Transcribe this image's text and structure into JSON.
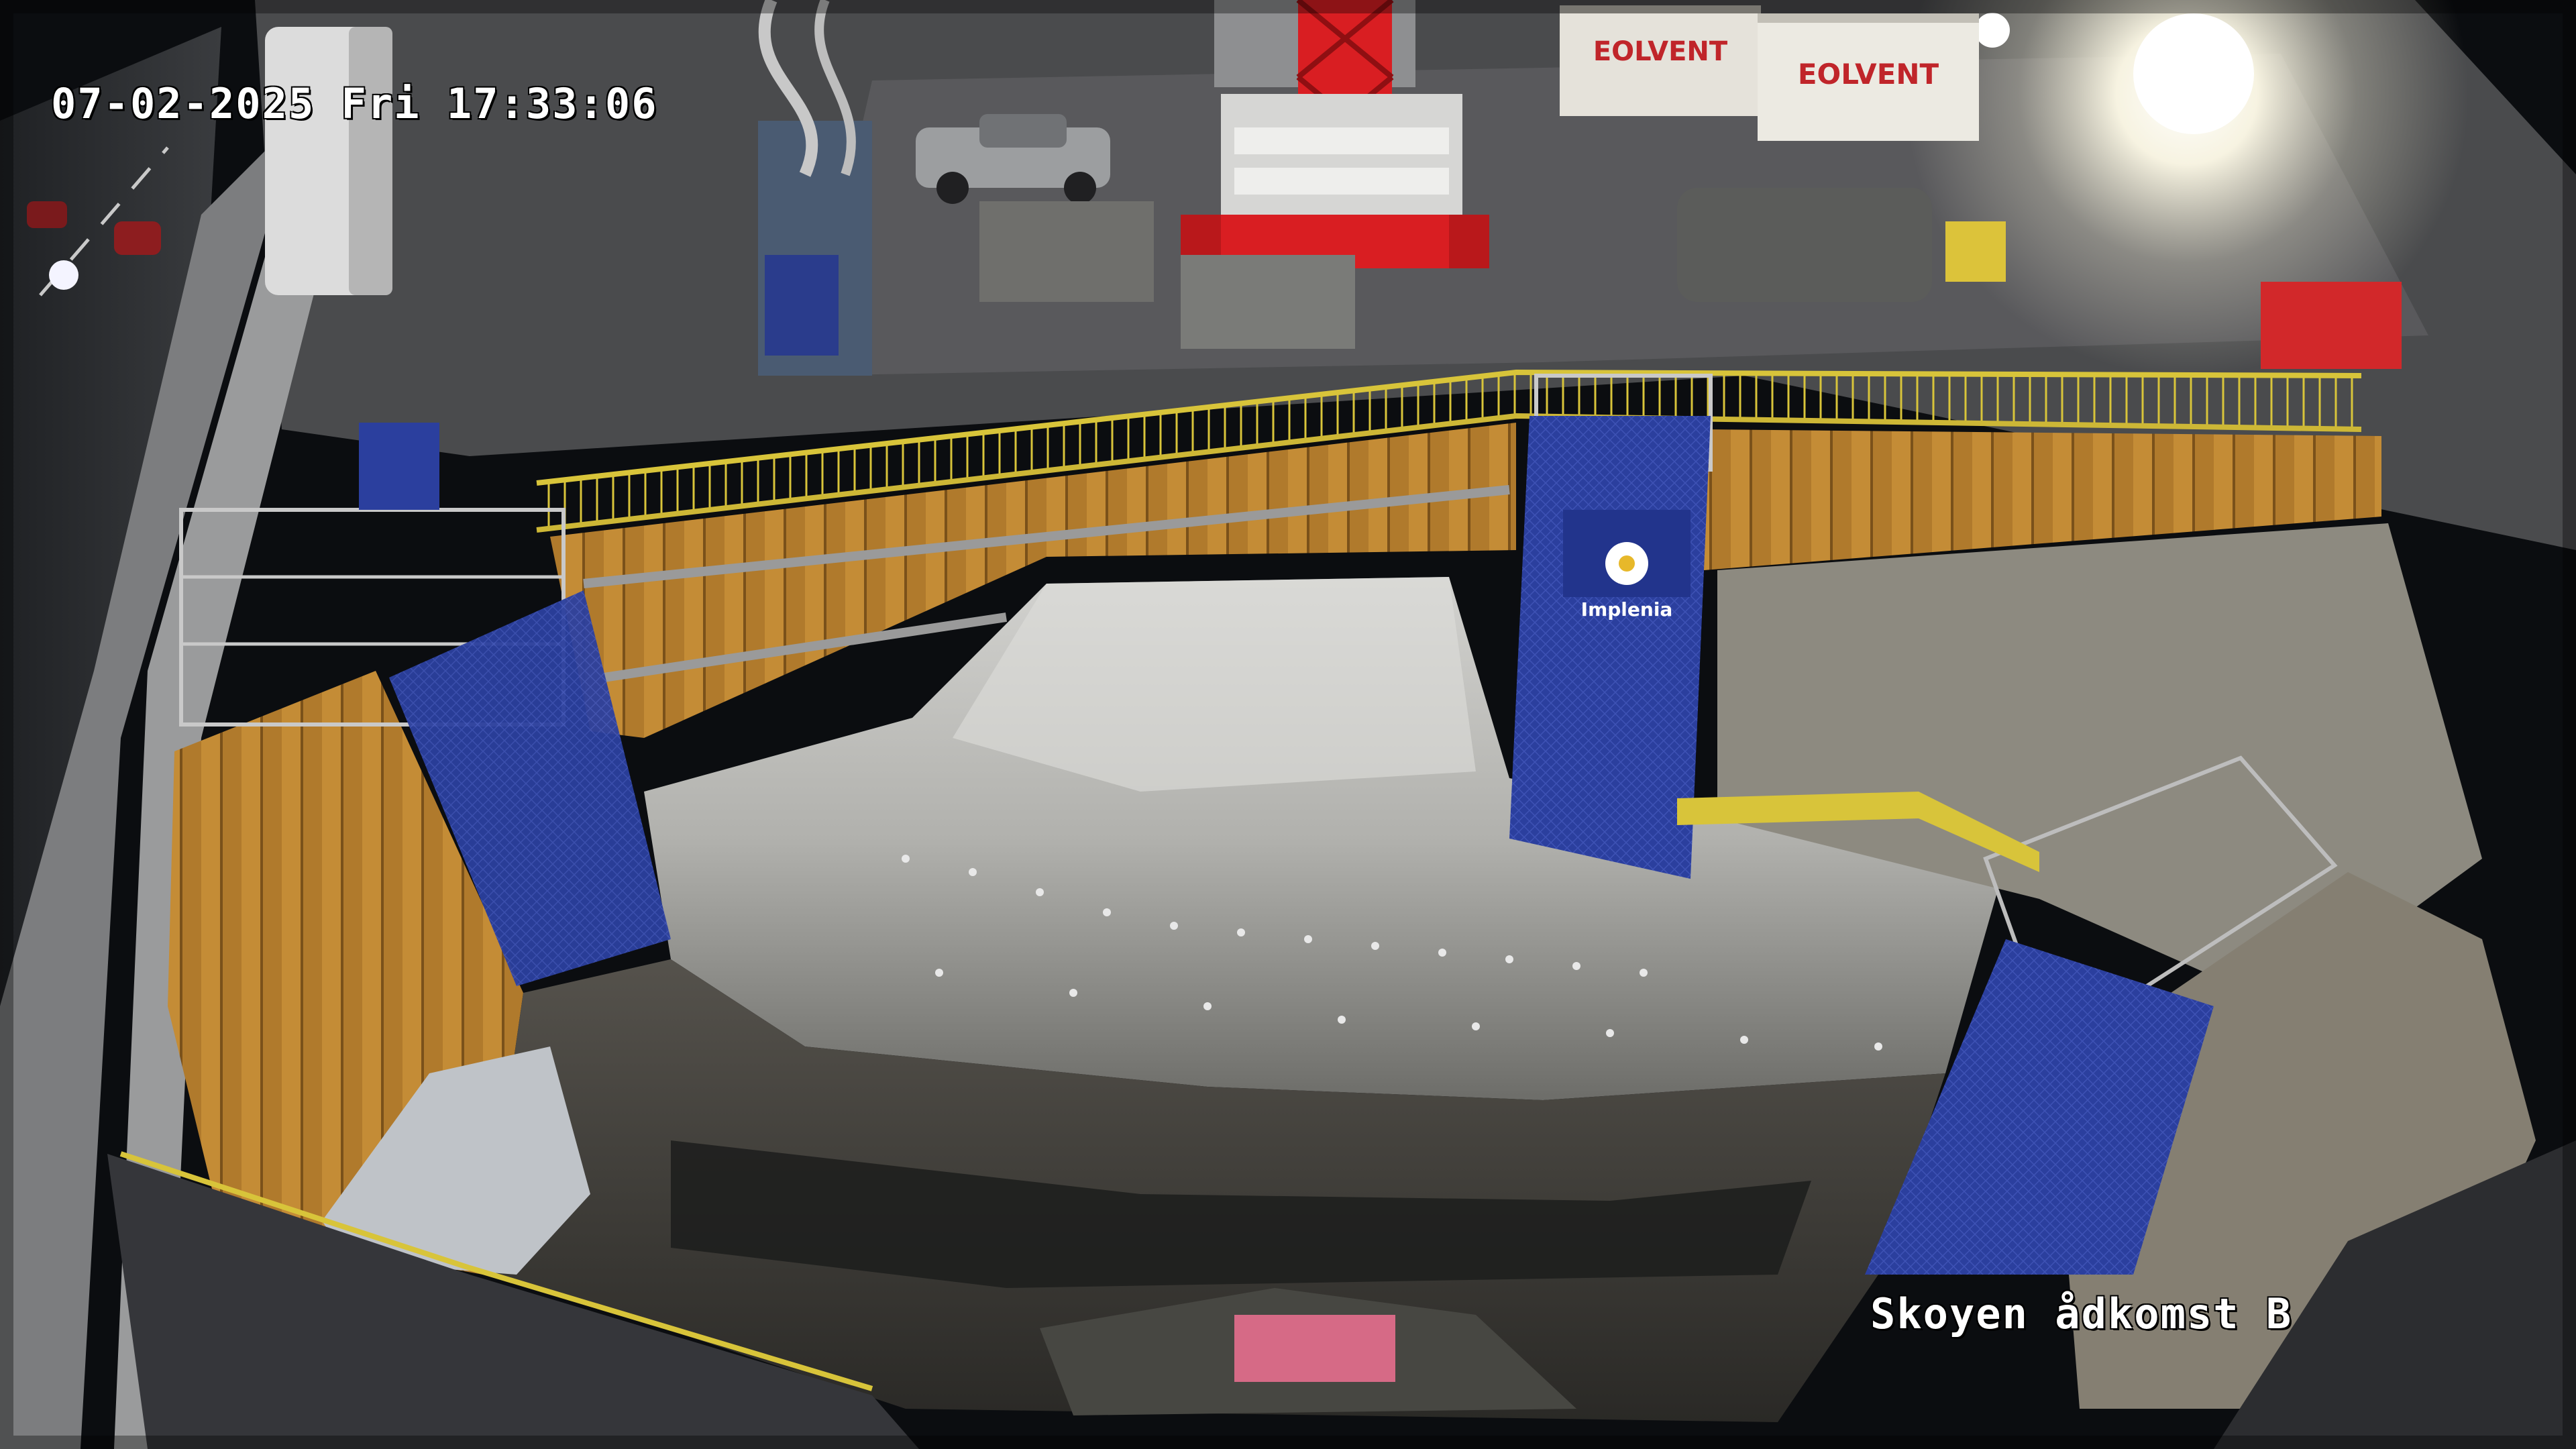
{
  "overlay": {
    "timestamp": "07-02-2025 Fri 17:33:06",
    "camera_name": "Skoyen ådkomst B"
  },
  "signage": {
    "banner_brand": "Implenia",
    "container_left": "EOLVENT",
    "container_right": "EOLVENT"
  },
  "colors": {
    "osd_text": "#ffffff",
    "sheet_pile": "#b07a2c",
    "scaffold_mesh": "#2b3f9e",
    "crane_red": "#d91e22",
    "railing_yellow": "#d8c43a",
    "rock": "#b9b9b6",
    "night_sky": "#0b0d10"
  }
}
